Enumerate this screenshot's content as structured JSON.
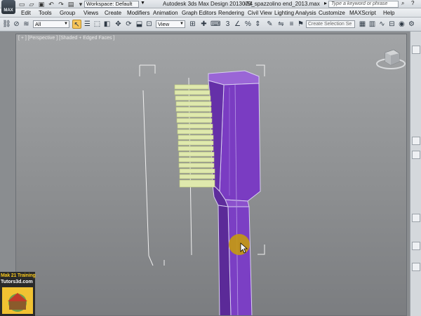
{
  "titlebar": {
    "workspace_label": "Workspace: Default",
    "app_title": "Autodesk 3ds Max Design 2013 x64",
    "file_name": "079_spazzolino end_2013.max",
    "search_placeholder": "Type a keyword or phrase",
    "app_logo_text": "MAX"
  },
  "menu": {
    "items": [
      "Edit",
      "Tools",
      "Group",
      "Views",
      "Create",
      "Modifiers",
      "Animation",
      "Graph Editors",
      "Rendering",
      "Civil View",
      "Lighting Analysis",
      "Customize",
      "MAXScript",
      "Help"
    ]
  },
  "toolbar": {
    "filter_value": "All",
    "refcoord_value": "View",
    "snap_label": "3",
    "selection_set_placeholder": "Create Selection Se"
  },
  "viewport": {
    "label": "[ + ] [Perspective ] [Shaded + Edged Faces ]"
  },
  "watermark": {
    "line1": "Mak 21 Training",
    "line2": "Tutors3d.com"
  },
  "colors": {
    "handle": "#7c3fc0",
    "bristles": "#d9e6a5",
    "cursor_highlight": "#c59a10"
  },
  "icons": [
    "app-logo-icon",
    "new-file-icon",
    "open-file-icon",
    "save-file-icon",
    "undo-icon",
    "redo-icon",
    "search-icon",
    "help-icon",
    "view-cube-icon"
  ]
}
